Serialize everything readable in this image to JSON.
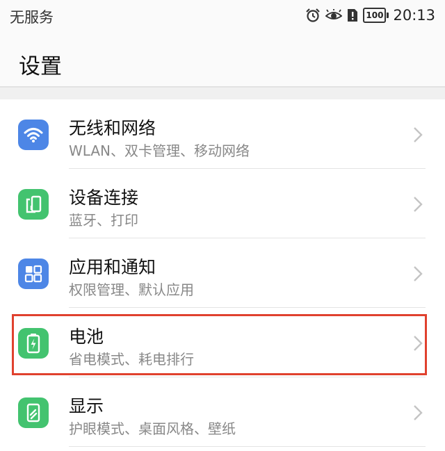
{
  "status_bar": {
    "carrier": "无服务",
    "icons": [
      "alarm-icon",
      "eye-comfort-icon",
      "sim-alert-icon"
    ],
    "battery_level": "100",
    "time": "20:13"
  },
  "header": {
    "title": "设置"
  },
  "settings": [
    {
      "icon": "wifi-icon",
      "icon_color": "#4d86e6",
      "title": "无线和网络",
      "subtitle": "WLAN、双卡管理、移动网络"
    },
    {
      "icon": "device-connection-icon",
      "icon_color": "#43c36f",
      "title": "设备连接",
      "subtitle": "蓝牙、打印"
    },
    {
      "icon": "apps-icon",
      "icon_color": "#4d86e6",
      "title": "应用和通知",
      "subtitle": "权限管理、默认应用"
    },
    {
      "icon": "battery-icon",
      "icon_color": "#43c36f",
      "title": "电池",
      "subtitle": "省电模式、耗电排行"
    },
    {
      "icon": "display-icon",
      "icon_color": "#43c36f",
      "title": "显示",
      "subtitle": "护眼模式、桌面风格、壁纸"
    }
  ],
  "highlight_color": "#e0412e"
}
